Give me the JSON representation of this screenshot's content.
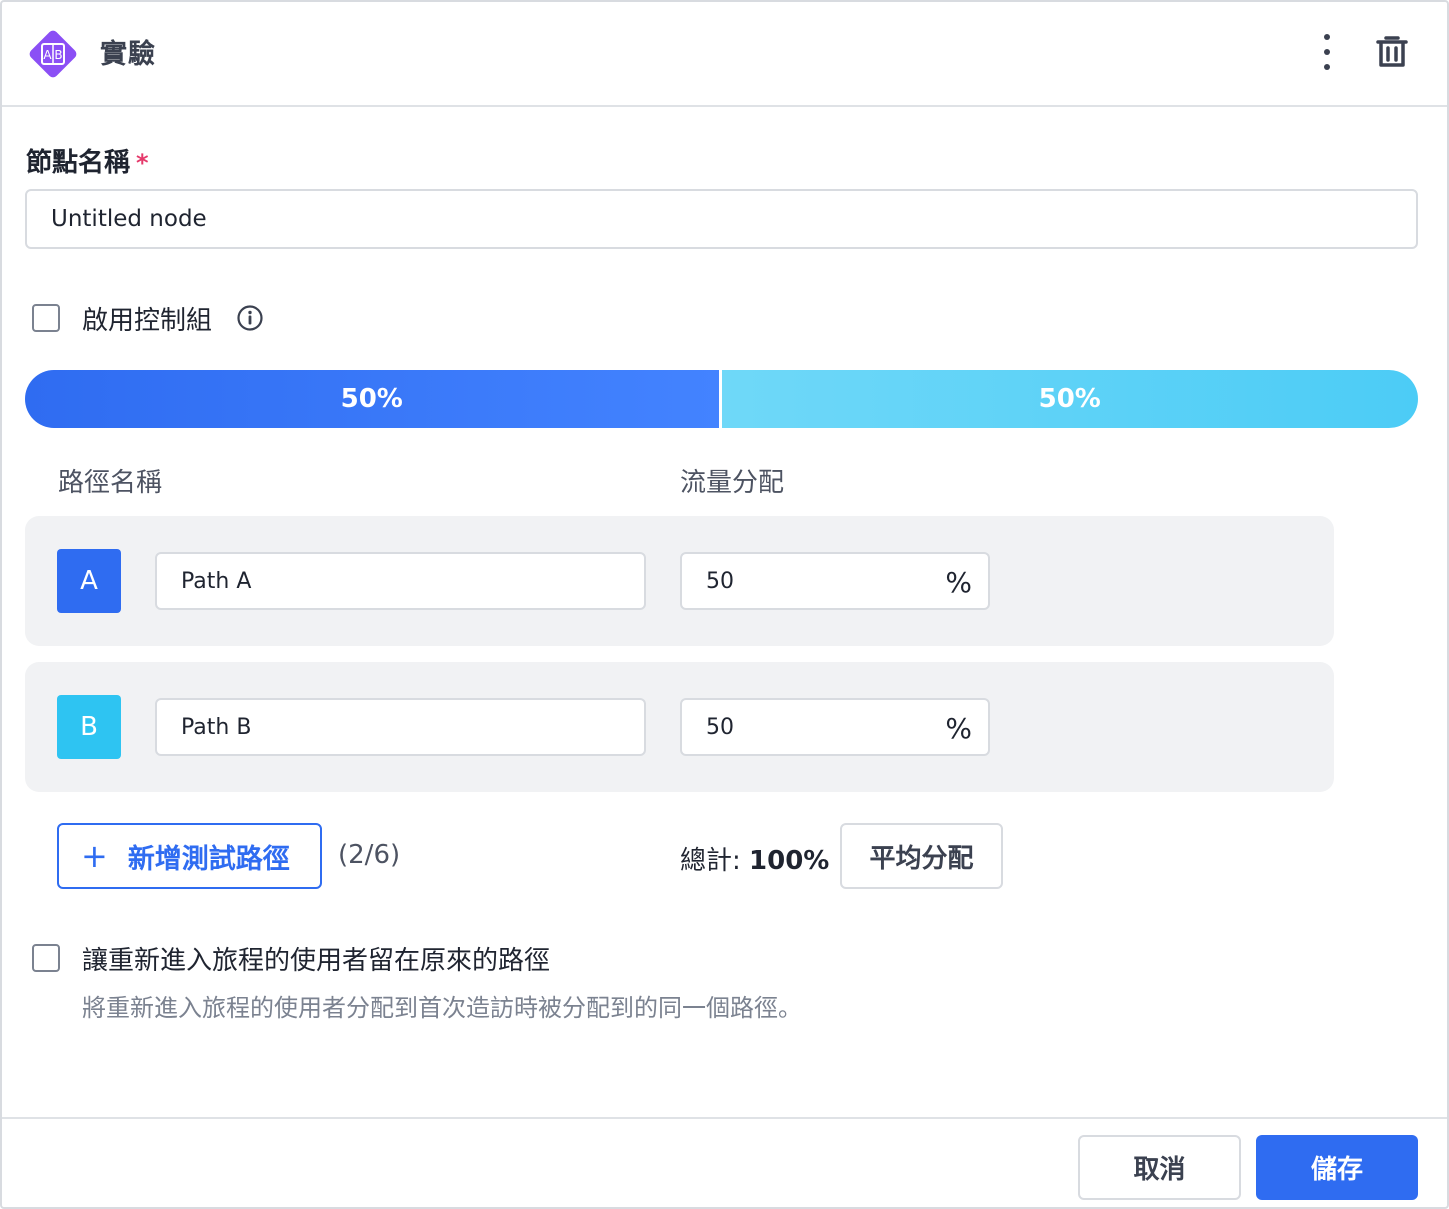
{
  "header": {
    "title": "實驗",
    "logo_icon": "ab-test-icon",
    "more_icon": "more-vertical-icon",
    "trash_icon": "trash-icon"
  },
  "node_name": {
    "label": "節點名稱",
    "required_mark": "*",
    "value": "Untitled node"
  },
  "control_group": {
    "label": "啟用控制組",
    "checked": false,
    "info_icon": "info-icon"
  },
  "split_bar": {
    "segments": [
      {
        "label": "50%",
        "fraction": 0.5,
        "color": "#2f6cf1"
      },
      {
        "label": "50%",
        "fraction": 0.5,
        "color": "#4cccf6"
      }
    ]
  },
  "columns": {
    "path_name": "路徑名稱",
    "traffic": "流量分配"
  },
  "paths": [
    {
      "badge": "A",
      "name": "Path A",
      "allocation": "50",
      "unit": "%",
      "color": "#2f6cf1"
    },
    {
      "badge": "B",
      "name": "Path B",
      "allocation": "50",
      "unit": "%",
      "color": "#2ec4f2"
    }
  ],
  "actions": {
    "add_path_label": "新增測試路徑",
    "add_path_icon": "plus-icon",
    "count": "(2/6)",
    "total_label": "總計:",
    "total_value": "100%",
    "even_split_label": "平均分配"
  },
  "reentry": {
    "label": "讓重新進入旅程的使用者留在原來的路徑",
    "description": "將重新進入旅程的使用者分配到首次造訪時被分配到的同一個路徑。",
    "checked": false
  },
  "footer": {
    "cancel_label": "取消",
    "save_label": "儲存"
  }
}
